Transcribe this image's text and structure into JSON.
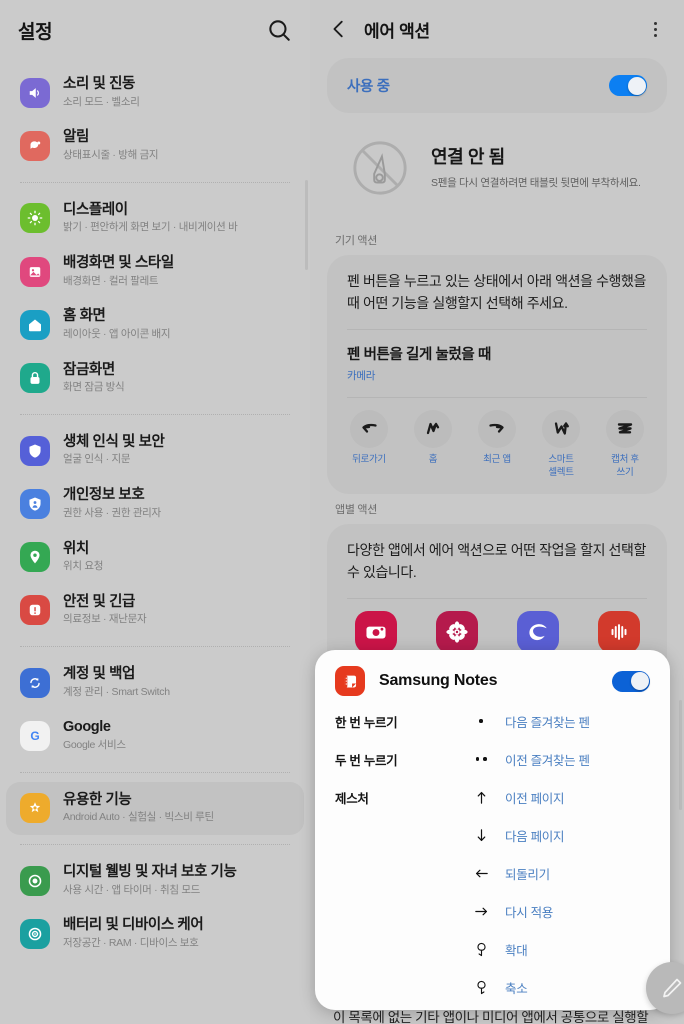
{
  "sidebar": {
    "title": "설정",
    "search_icon": "search-icon",
    "items": [
      {
        "label": "소리 및 진동",
        "sub": "소리 모드 · 벨소리",
        "icon": "volume-icon",
        "color": "#7b6ad3",
        "selected": false
      },
      {
        "label": "알림",
        "sub": "상태표시줄 · 방해 금지",
        "icon": "notification-icon",
        "color": "#e0695f",
        "selected": false
      },
      {
        "divider": true
      },
      {
        "label": "디스플레이",
        "sub": "밝기 · 편안하게 화면 보기 · 내비게이션 바",
        "icon": "brightness-icon",
        "color": "#6cbe2e",
        "selected": false
      },
      {
        "label": "배경화면 및 스타일",
        "sub": "배경화면 · 컬러 팔레트",
        "icon": "wallpaper-icon",
        "color": "#e0487e",
        "selected": false
      },
      {
        "label": "홈 화면",
        "sub": "레이아웃 · 앱 아이콘 배지",
        "icon": "home-icon",
        "color": "#1a9fc4",
        "selected": false
      },
      {
        "label": "잠금화면",
        "sub": "화면 잠금 방식",
        "icon": "lock-icon",
        "color": "#1fa98c",
        "selected": false
      },
      {
        "divider": true
      },
      {
        "label": "생체 인식 및 보안",
        "sub": "얼굴 인식 · 지문",
        "icon": "shield-icon",
        "color": "#5560d8",
        "selected": false
      },
      {
        "label": "개인정보 보호",
        "sub": "권한 사용 · 권한 관리자",
        "icon": "privacy-icon",
        "color": "#4a80df",
        "selected": false
      },
      {
        "label": "위치",
        "sub": "위치 요청",
        "icon": "location-pin-icon",
        "color": "#34a853",
        "selected": false
      },
      {
        "label": "안전 및 긴급",
        "sub": "의료정보 · 재난문자",
        "icon": "warning-icon",
        "color": "#d94a43",
        "selected": false
      },
      {
        "divider": true
      },
      {
        "label": "계정 및 백업",
        "sub": "계정 관리 · Smart Switch",
        "icon": "sync-icon",
        "color": "#3d6fd4",
        "selected": false
      },
      {
        "label": "Google",
        "sub": "Google 서비스",
        "icon": "google-icon",
        "color": "#f1f1f1",
        "selected": false
      },
      {
        "divider": true
      },
      {
        "label": "유용한 기능",
        "sub": "Android Auto · 실험실 · 빅스비 루틴",
        "icon": "star-burst-icon",
        "color": "#eeab2c",
        "selected": true
      },
      {
        "divider": true
      },
      {
        "label": "디지털 웰빙 및 자녀 보호 기능",
        "sub": "사용 시간 · 앱 타이머 · 취침 모드",
        "icon": "wellbeing-icon",
        "color": "#3a9b4e",
        "selected": false
      },
      {
        "label": "배터리 및 디바이스 케어",
        "sub": "저장공간 · RAM · 디바이스 보호",
        "icon": "devicecare-icon",
        "color": "#1ba0a0",
        "selected": false
      }
    ]
  },
  "panel": {
    "back_icon": "chevron-left-icon",
    "title": "에어 액션",
    "more_icon": "overflow-menu-icon",
    "master_toggle": {
      "label": "사용 중",
      "enabled": true
    },
    "status": {
      "icon": "spen-disconnected-icon",
      "title": "연결 안 됨",
      "subtitle": "S펜을 다시 연결하려면 태블릿 뒷면에 부착하세요."
    },
    "device_actions": {
      "section_label": "기기 액션",
      "description": "펜 버튼을 누르고 있는 상태에서 아래 액션을 수행했을 때 어떤 기능을 실행할지 선택해 주세요.",
      "option_title": "펜 버튼을 길게 눌렀을 때",
      "option_value": "카메라",
      "gestures": [
        {
          "label": "뒤로가기",
          "icon": "gesture-swipe-left-icon"
        },
        {
          "label": "홈",
          "icon": "gesture-swipe-updown-icon"
        },
        {
          "label": "최근 앱",
          "icon": "gesture-swipe-right-icon"
        },
        {
          "label": "스마트\n셀렉트",
          "icon": "gesture-v-up-icon"
        },
        {
          "label": "캡처 후\n쓰기",
          "icon": "gesture-zigzag-icon"
        }
      ]
    },
    "app_actions": {
      "section_label": "앱별 액션",
      "description": "다양한 앱에서 에어 액션으로 어떤 작업을 할지 선택할 수 있습니다.",
      "apps": [
        {
          "label": "카메라",
          "icon": "camera-app-icon",
          "color": "#cb1448"
        },
        {
          "label": "갤러리",
          "icon": "gallery-app-icon",
          "color": "#b51a4c"
        },
        {
          "label": "삼성 인터넷",
          "icon": "samsung-internet-app-icon",
          "color": "#5a5fd4"
        },
        {
          "label": "음성 녹음",
          "icon": "voice-recorder-app-icon",
          "color": "#d23a2c"
        }
      ]
    },
    "bottom_note": "이 목록에 없는 기타 앱이나 미디어 앱에서 공통으로 실행할 액션",
    "fab_icon": "pen-edit-icon"
  },
  "notes_sheet": {
    "app_icon": "samsung-notes-icon",
    "app_name": "Samsung Notes",
    "toggle_enabled": true,
    "rows": [
      {
        "label": "한 번 누르기",
        "symbol_icon": "one-dot-icon",
        "value": "다음 즐겨찾는 펜"
      },
      {
        "label": "두 번 누르기",
        "symbol_icon": "two-dots-icon",
        "value": "이전 즐겨찾는 펜"
      },
      {
        "label": "제스처",
        "symbol_icon": "arrow-up-icon",
        "value": "이전 페이지"
      },
      {
        "label": "",
        "symbol_icon": "arrow-down-icon",
        "value": "다음 페이지"
      },
      {
        "label": "",
        "symbol_icon": "arrow-left-icon",
        "value": "되돌리기"
      },
      {
        "label": "",
        "symbol_icon": "arrow-right-icon",
        "value": "다시 적용"
      },
      {
        "label": "",
        "symbol_icon": "rotate-cw-icon",
        "value": "확대"
      },
      {
        "label": "",
        "symbol_icon": "rotate-ccw-icon",
        "value": "축소"
      }
    ]
  },
  "colors": {
    "accent_blue": "#3c6fbd",
    "toggle_on": "#0c7ff2",
    "background": "#c9c9c9",
    "card": "#c2c2c2",
    "sheet": "#fdfdfd"
  }
}
